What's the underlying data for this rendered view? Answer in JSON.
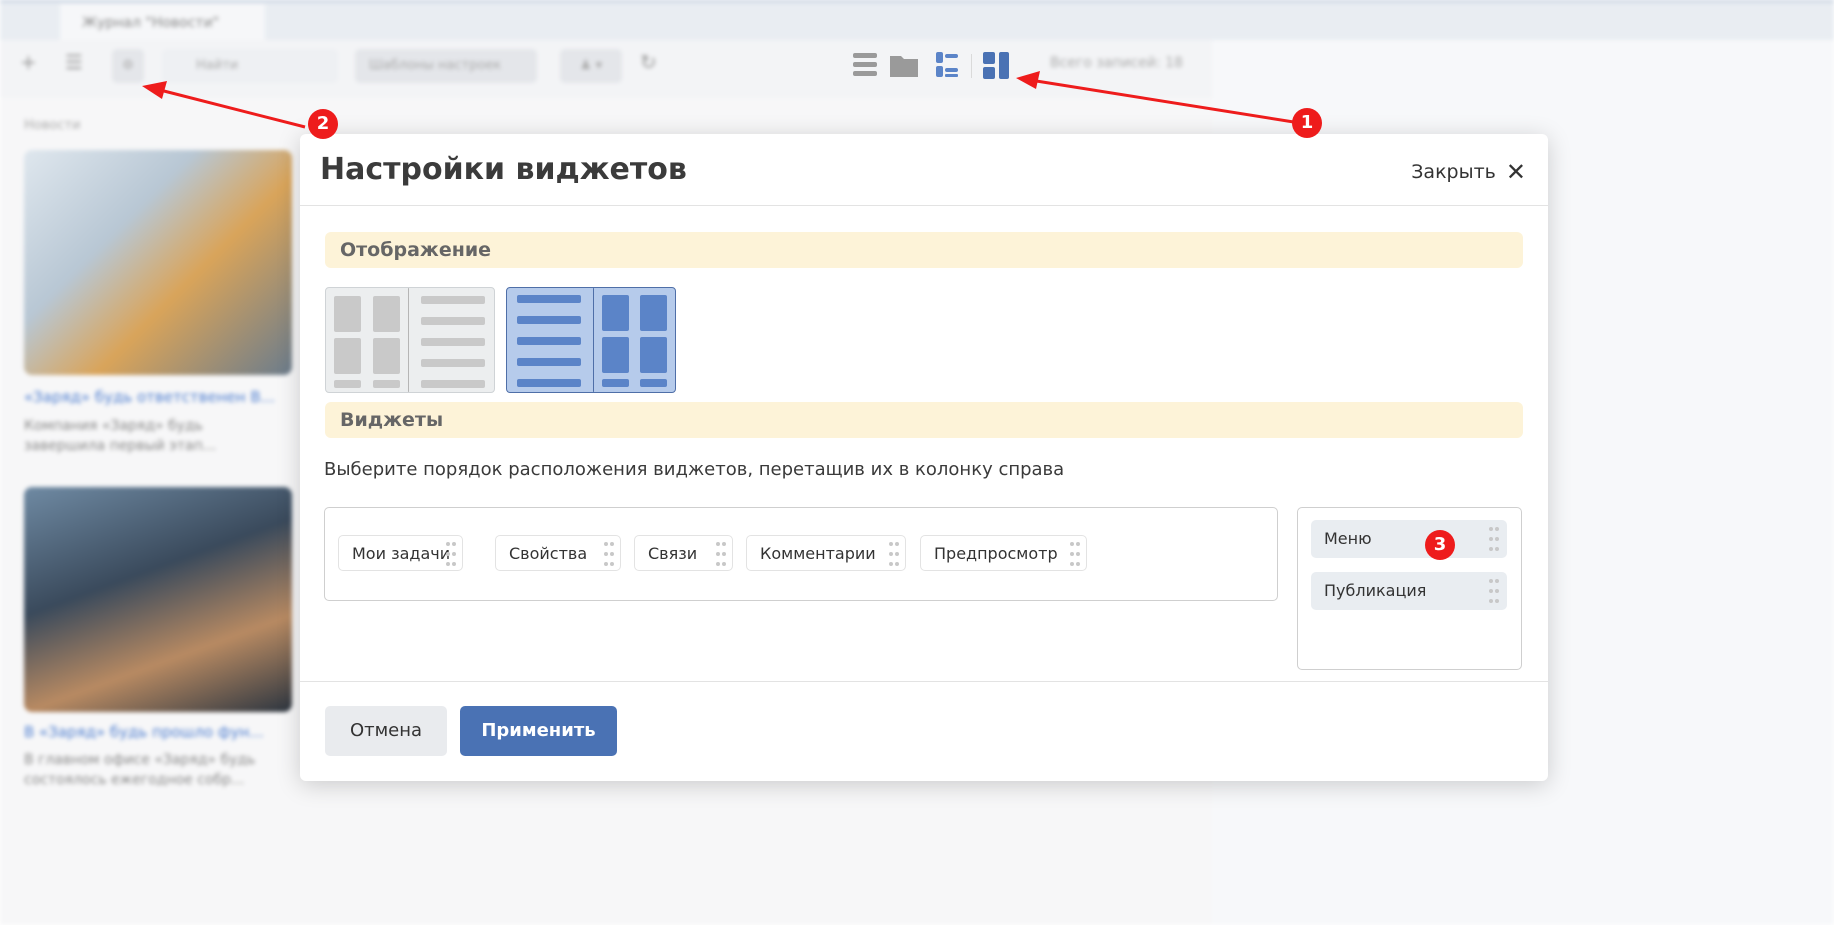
{
  "background": {
    "tab_title": "Журнал \"Новости\"",
    "toolbar": {
      "search_placeholder": "Найти",
      "templates_label": "Шаблоны настроек",
      "total_label": "Всего записей: 18"
    },
    "section_label": "Новости",
    "cards": [
      {
        "title": "«Заряд» будь ответственен В...",
        "text": "Компания «Заряд» будь завершила первый этап..."
      },
      {
        "title": "В «Заряд» будь прошло фун...",
        "text": "В главном офисе «Заряд» будь состоялось ежегодное собр..."
      }
    ]
  },
  "modal": {
    "title": "Настройки виджетов",
    "close_label": "Закрыть",
    "display_section": "Отображение",
    "widgets_section": "Виджеты",
    "description": "Выберите порядок расположения виджетов, перетащив их в колонку справа",
    "available_widgets": [
      "Мои задачи",
      "Свойства",
      "Связи",
      "Комментарии",
      "Предпросмотр"
    ],
    "selected_widgets": [
      "Меню",
      "Публикация"
    ],
    "cancel_label": "Отмена",
    "apply_label": "Применить"
  },
  "annotations": {
    "markers": [
      "1",
      "2",
      "3"
    ],
    "color": "#ee1c1c"
  },
  "colors": {
    "accent": "#4a72b4",
    "section_bg": "#fdf3d8",
    "selected_layout": "#b6cbeb"
  }
}
